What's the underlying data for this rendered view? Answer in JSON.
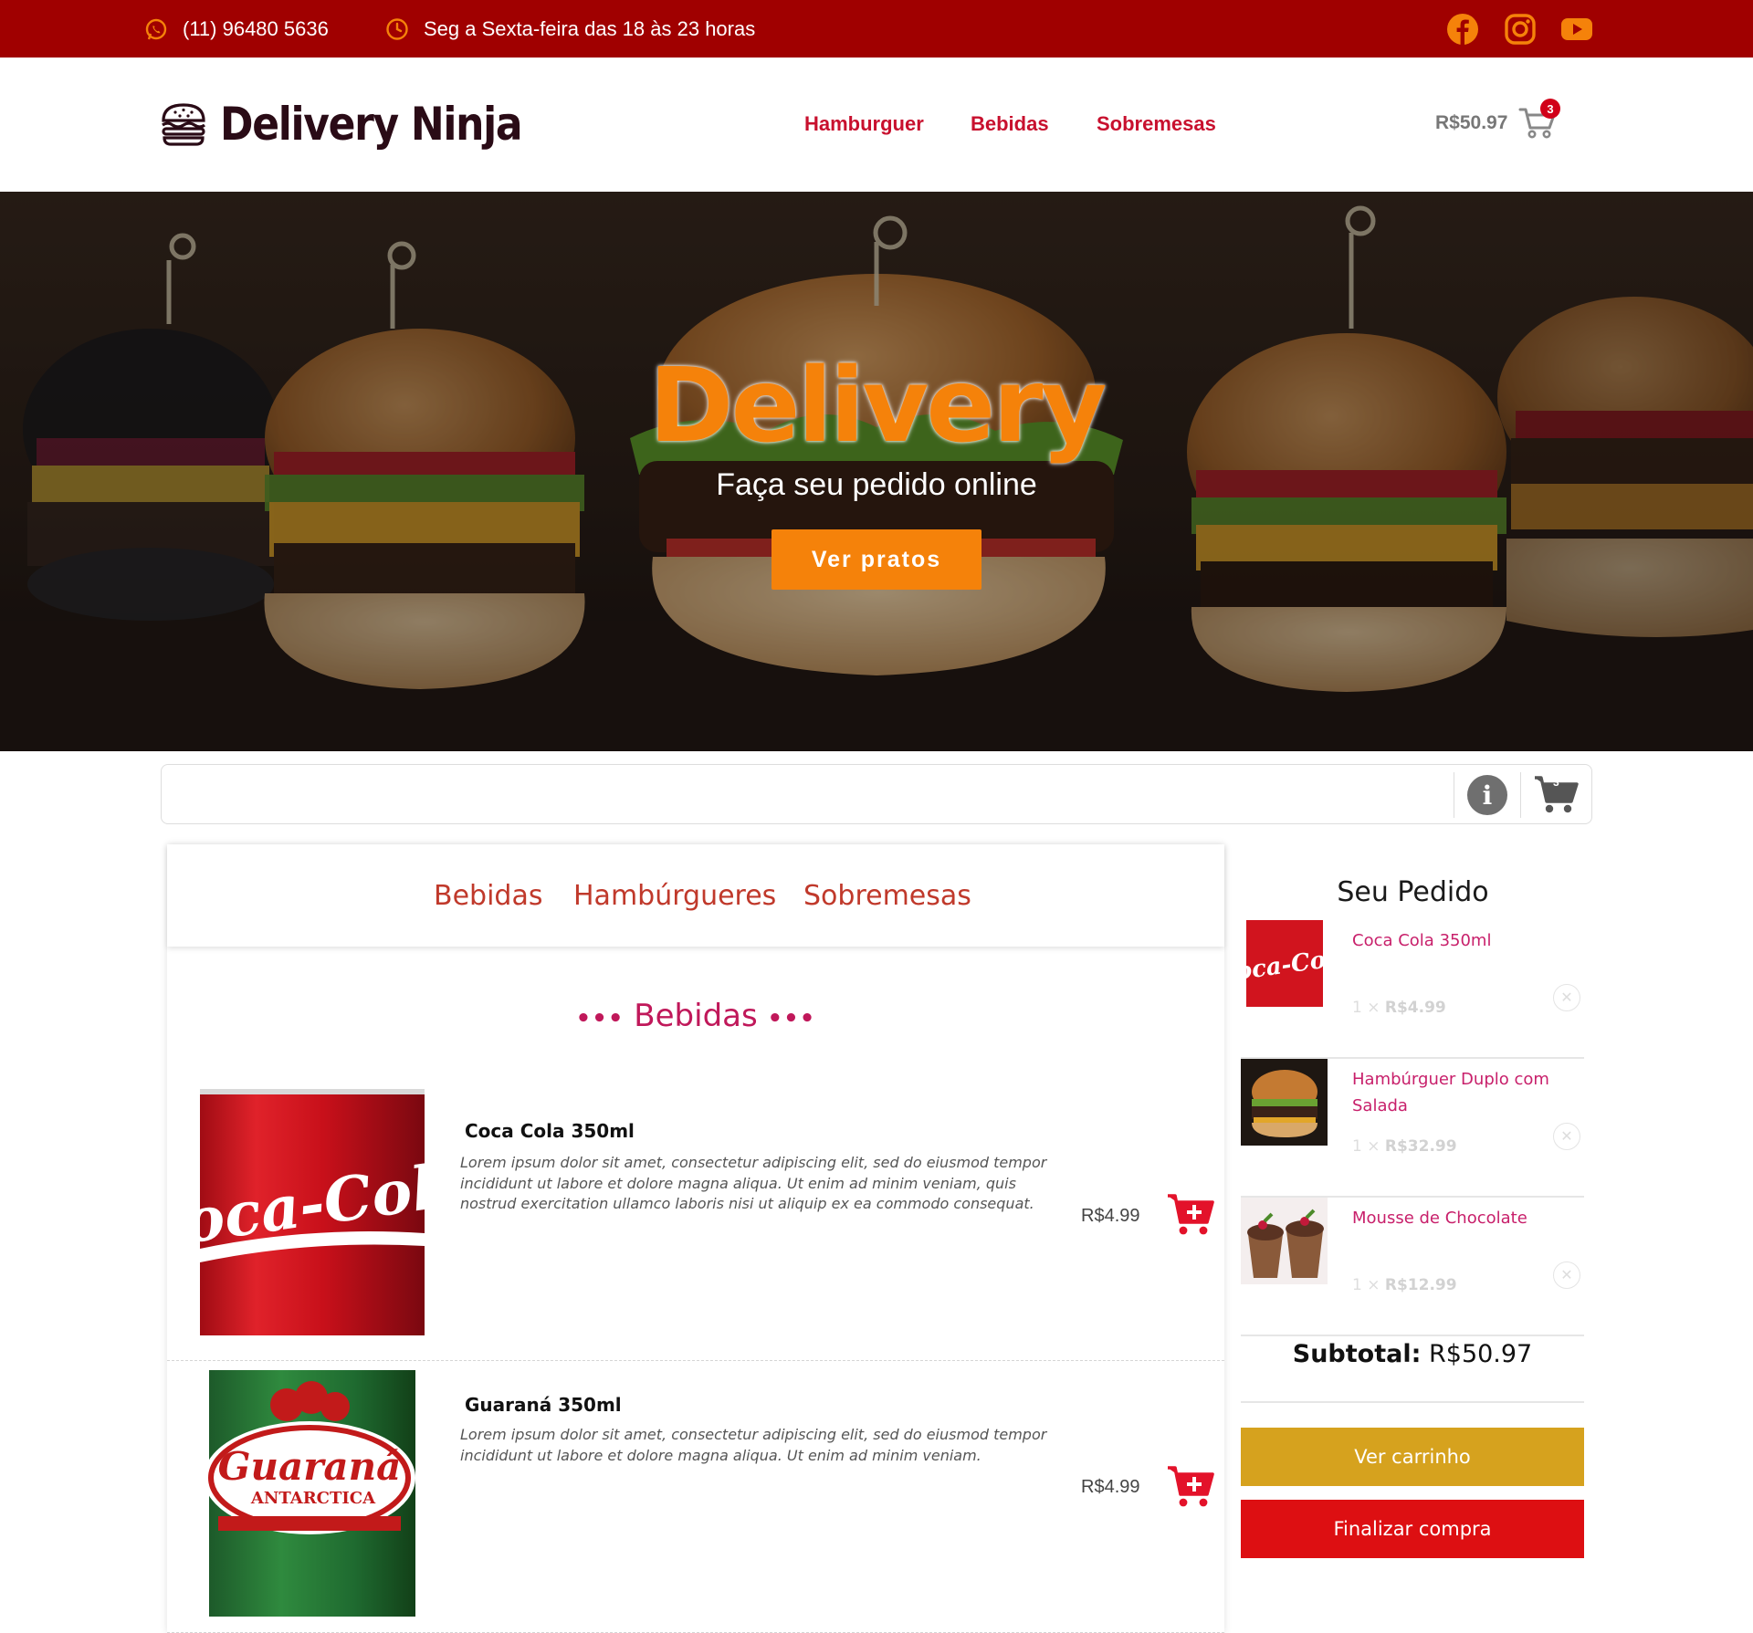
{
  "topbar": {
    "phone": "(11) 96480 5636",
    "hours": "Seg a Sexta-feira das 18 às 23 horas",
    "social": [
      "facebook-icon",
      "instagram-icon",
      "youtube-icon"
    ],
    "icon_color": "#f5820a",
    "background": "#a00000"
  },
  "header": {
    "logo_text": "Delivery Ninja",
    "nav": [
      "Hamburguer",
      "Bebidas",
      "Sobremesas"
    ],
    "cart_total": "R$50.97",
    "cart_count": "3",
    "accent": "#c8102e"
  },
  "hero": {
    "title": "Delivery",
    "subtitle": "Faça seu pedido online",
    "button": "Ver pratos",
    "accent": "#f5820a"
  },
  "searchbar": {
    "cart_count": "3"
  },
  "menu": {
    "tabs": [
      "Bebidas",
      "Hambúrgueres",
      "Sobremesas"
    ],
    "section_title": "Bebidas",
    "products": [
      {
        "name": "Coca Cola 350ml",
        "description": "Lorem ipsum dolor sit amet, consectetur adipiscing elit, sed do eiusmod tempor incididunt ut labore et dolore magna aliqua. Ut enim ad minim veniam, quis nostrud exercitation ullamco laboris nisi ut aliquip ex ea commodo consequat.",
        "price": "R$4.99",
        "image": "coca-cola-can"
      },
      {
        "name": "Guaraná 350ml",
        "description": "Lorem ipsum dolor sit amet, consectetur adipiscing elit, sed do eiusmod tempor incididunt ut labore et dolore magna aliqua. Ut enim ad minim veniam.",
        "price": "R$4.99",
        "image": "guarana-can"
      }
    ]
  },
  "order": {
    "title": "Seu Pedido",
    "items": [
      {
        "name": "Coca Cola 350ml",
        "qty": "1 ×",
        "price": "R$4.99"
      },
      {
        "name": "Hambúrguer Duplo com Salada",
        "qty": "1 ×",
        "price": "R$32.99"
      },
      {
        "name": "Mousse de Chocolate",
        "qty": "1 ×",
        "price": "R$12.99"
      }
    ],
    "subtotal_label": "Subtotal:",
    "subtotal_value": "R$50.97",
    "view_cart": "Ver carrinho",
    "checkout": "Finalizar compra",
    "view_cart_color": "#d6a21e",
    "checkout_color": "#dd0f12"
  }
}
